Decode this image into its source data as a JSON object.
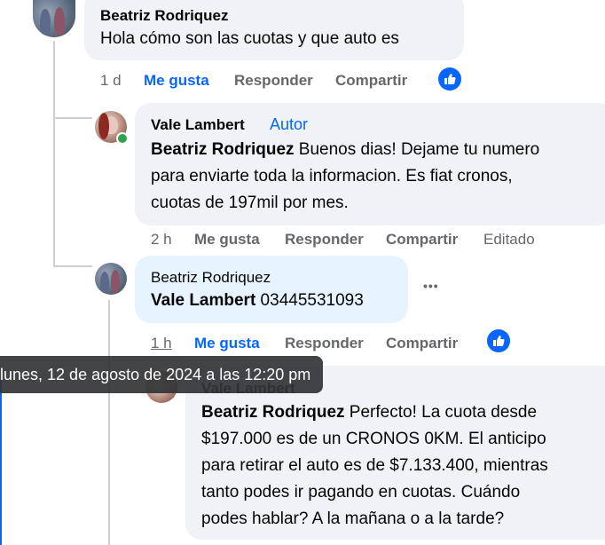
{
  "comments": [
    {
      "author": "Beatriz Rodriquez",
      "text": "Hola cómo son las cuotas y que auto es",
      "time": "1 d",
      "like": "Me gusta",
      "reply": "Responder",
      "share": "Compartir"
    },
    {
      "author": "Vale Lambert",
      "badge": "Autor",
      "mention": "Beatriz Rodriquez",
      "text_l1": " Buenos dias! Dejame tu numero",
      "text_l2": "para enviarte toda la informacion. Es fiat cronos,",
      "text_l3": "cuotas de 197mil por mes.",
      "time": "2 h",
      "like": "Me gusta",
      "reply": "Responder",
      "share": "Compartir",
      "edited": "Editado"
    },
    {
      "author": "Beatriz Rodriquez",
      "mention": "Vale Lambert",
      "text": " 03445531093",
      "time": "1 h",
      "like": "Me gusta",
      "reply": "Responder",
      "share": "Compartir",
      "more": "•••"
    },
    {
      "author": "Vale Lambert",
      "mention": "Beatriz Rodriquez",
      "text_l1": " Perfecto! La cuota desde",
      "text_l2": "$197.000 es de un CRONOS 0KM. El anticipo",
      "text_l3": "para retirar el auto es de $7.133.400, mientras",
      "text_l4": "tanto podes ir pagando en cuotas. Cuándo",
      "text_l5": "podes hablar? A la mañana o a la tarde?"
    }
  ],
  "tooltip": "lunes, 12 de agosto de 2024 a las 12:20 pm",
  "colors": {
    "link_blue": "#0866ff",
    "bubble_gray": "#f0f2f5",
    "bubble_blue": "#e7f3ff",
    "online_green": "#31a24c"
  },
  "icons": {
    "like_badge": "thumbs-up-icon",
    "more": "more-dots-icon"
  }
}
